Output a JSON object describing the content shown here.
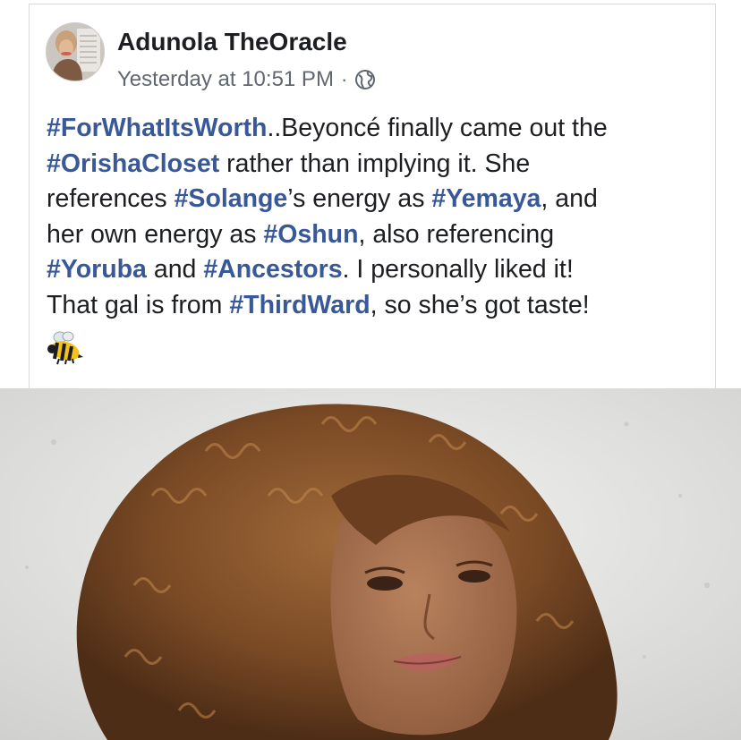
{
  "post": {
    "author": "Adunola TheOracle",
    "timestamp": "Yesterday at 10:51 PM",
    "separator": "·",
    "privacy_icon": "globe-icon",
    "lines": [
      [
        {
          "tag": true,
          "text": "#ForWhatItsWorth"
        },
        {
          "tag": false,
          "text": "..Beyoncé finally came out the"
        }
      ],
      [
        {
          "tag": true,
          "text": "#OrishaCloset"
        },
        {
          "tag": false,
          "text": " rather than implying it. She"
        }
      ],
      [
        {
          "tag": false,
          "text": "references "
        },
        {
          "tag": true,
          "text": "#Solange"
        },
        {
          "tag": false,
          "text": "’s energy as "
        },
        {
          "tag": true,
          "text": "#Yemaya"
        },
        {
          "tag": false,
          "text": ", and"
        }
      ],
      [
        {
          "tag": false,
          "text": "her own energy as "
        },
        {
          "tag": true,
          "text": "#Oshun"
        },
        {
          "tag": false,
          "text": ", also referencing"
        }
      ],
      [
        {
          "tag": true,
          "text": "#Yoruba"
        },
        {
          "tag": false,
          "text": " and "
        },
        {
          "tag": true,
          "text": "#Ancestors"
        },
        {
          "tag": false,
          "text": ". I personally liked it!"
        }
      ],
      [
        {
          "tag": false,
          "text": "That gal is from "
        },
        {
          "tag": true,
          "text": "#ThirdWard"
        },
        {
          "tag": false,
          "text": ", so she’s got taste!"
        }
      ]
    ],
    "emoji_icon": "bee-icon"
  },
  "colors": {
    "hashtag": "#385898",
    "text": "#1c1e21",
    "meta": "#606770",
    "card_border": "#d9dadd"
  }
}
